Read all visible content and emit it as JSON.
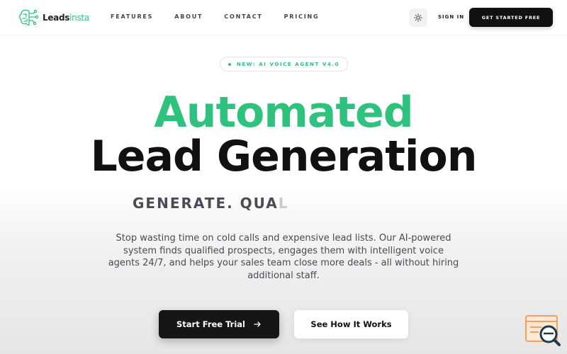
{
  "brand": {
    "name_main": "Leads",
    "name_accent": "insta",
    "icon": "brain-circuit-logo"
  },
  "nav": {
    "links": [
      "FEATURES",
      "ABOUT",
      "CONTACT",
      "PRICING"
    ],
    "theme_icon": "sun-icon",
    "signin_label": "SIGN IN",
    "cta_label": "GET STARTED FREE"
  },
  "hero": {
    "badge": "NEW: AI VOICE AGENT V4.0",
    "headline_line1": "Automated",
    "headline_line2": "Lead Generation",
    "typing_text_visible": "GENERATE. QUA",
    "typing_text_fading": "L",
    "description": "Stop wasting time on cold calls and expensive lead lists. Our AI-powered system finds qualified prospects, engages them with intelligent voice agents 24/7, and helps your sales team close more deals - all without hiring additional staff.",
    "primary_button": "Start Free Trial",
    "primary_button_icon": "arrow-right-icon",
    "secondary_button": "See How It Works"
  },
  "floating_widget": {
    "icon": "search-window-icon"
  },
  "colors": {
    "accent": "#2ec27e",
    "dark": "#111111",
    "widget": "#f0a060"
  }
}
